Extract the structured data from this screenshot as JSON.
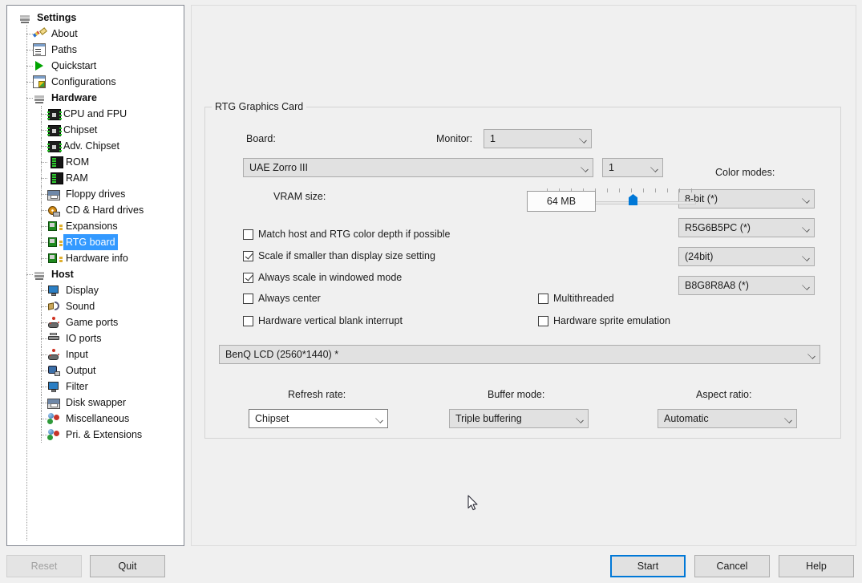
{
  "window": {
    "tree_root_label": "Settings"
  },
  "sidebar": {
    "items": [
      {
        "label": "Settings",
        "icon": "stack-icon",
        "level": 0,
        "bold": true,
        "selected": false
      },
      {
        "label": "About",
        "icon": "pencil-icon",
        "level": 1,
        "bold": false,
        "selected": false
      },
      {
        "label": "Paths",
        "icon": "window-icon",
        "level": 1,
        "bold": false,
        "selected": false
      },
      {
        "label": "Quickstart",
        "icon": "play-icon",
        "level": 1,
        "bold": false,
        "selected": false
      },
      {
        "label": "Configurations",
        "icon": "config-icon",
        "level": 1,
        "bold": false,
        "selected": false
      },
      {
        "label": "Hardware",
        "icon": "stack-icon",
        "level": 1,
        "bold": true,
        "selected": false
      },
      {
        "label": "CPU and FPU",
        "icon": "chip-icon",
        "level": 2,
        "bold": false,
        "selected": false
      },
      {
        "label": "Chipset",
        "icon": "chip-icon",
        "level": 2,
        "bold": false,
        "selected": false
      },
      {
        "label": "Adv. Chipset",
        "icon": "chip-icon",
        "level": 2,
        "bold": false,
        "selected": false
      },
      {
        "label": "ROM",
        "icon": "memory-icon",
        "level": 2,
        "bold": false,
        "selected": false
      },
      {
        "label": "RAM",
        "icon": "memory-icon",
        "level": 2,
        "bold": false,
        "selected": false
      },
      {
        "label": "Floppy drives",
        "icon": "floppy-icon",
        "level": 2,
        "bold": false,
        "selected": false
      },
      {
        "label": "CD & Hard drives",
        "icon": "cd-icon",
        "level": 2,
        "bold": false,
        "selected": false
      },
      {
        "label": "Expansions",
        "icon": "expansion-icon",
        "level": 2,
        "bold": false,
        "selected": false
      },
      {
        "label": "RTG board",
        "icon": "expansion-icon",
        "level": 2,
        "bold": false,
        "selected": true
      },
      {
        "label": "Hardware info",
        "icon": "expansion-icon",
        "level": 2,
        "bold": false,
        "selected": false
      },
      {
        "label": "Host",
        "icon": "stack-icon",
        "level": 1,
        "bold": true,
        "selected": false
      },
      {
        "label": "Display",
        "icon": "monitor-icon",
        "level": 2,
        "bold": false,
        "selected": false
      },
      {
        "label": "Sound",
        "icon": "sound-icon",
        "level": 2,
        "bold": false,
        "selected": false
      },
      {
        "label": "Game ports",
        "icon": "joystick-icon",
        "level": 2,
        "bold": false,
        "selected": false
      },
      {
        "label": "IO ports",
        "icon": "ioport-icon",
        "level": 2,
        "bold": false,
        "selected": false
      },
      {
        "label": "Input",
        "icon": "joystick-icon",
        "level": 2,
        "bold": false,
        "selected": false
      },
      {
        "label": "Output",
        "icon": "output-icon",
        "level": 2,
        "bold": false,
        "selected": false
      },
      {
        "label": "Filter",
        "icon": "monitor-icon",
        "level": 2,
        "bold": false,
        "selected": false
      },
      {
        "label": "Disk swapper",
        "icon": "floppy-icon",
        "level": 2,
        "bold": false,
        "selected": false
      },
      {
        "label": "Miscellaneous",
        "icon": "balls-icon",
        "level": 2,
        "bold": false,
        "selected": false
      },
      {
        "label": "Pri. & Extensions",
        "icon": "balls-icon",
        "level": 2,
        "bold": false,
        "selected": false
      }
    ]
  },
  "main": {
    "group_title": "RTG Graphics Card",
    "board_label": "Board:",
    "board_value": "UAE Zorro III",
    "monitor_label": "Monitor:",
    "monitor_value": "1",
    "monitor_index_value": "1",
    "color_modes_label": "Color modes:",
    "color_modes": [
      "8-bit (*)",
      "R5G6B5PC (*)",
      "(24bit)",
      "B8G8R8A8 (*)"
    ],
    "vram_label": "VRAM size:",
    "vram_value": "64 MB",
    "vram_slider": {
      "position_percent": 59,
      "tick_count": 13
    },
    "checkboxes_left": [
      {
        "label": "Match host and RTG color depth if possible",
        "checked": false
      },
      {
        "label": "Scale if smaller than display size setting",
        "checked": true
      },
      {
        "label": "Always scale in windowed mode",
        "checked": true
      },
      {
        "label": "Always center",
        "checked": false
      },
      {
        "label": "Hardware vertical blank interrupt",
        "checked": false
      }
    ],
    "checkboxes_right": [
      {
        "label": "Multithreaded",
        "checked": false
      },
      {
        "label": "Hardware sprite emulation",
        "checked": false
      }
    ],
    "display_mode_value": "BenQ LCD (2560*1440) *",
    "refresh_rate_label": "Refresh rate:",
    "refresh_rate_value": "Chipset",
    "buffer_mode_label": "Buffer mode:",
    "buffer_mode_value": "Triple buffering",
    "aspect_ratio_label": "Aspect ratio:",
    "aspect_ratio_value": "Automatic"
  },
  "footer": {
    "reset_label": "Reset",
    "quit_label": "Quit",
    "start_label": "Start",
    "cancel_label": "Cancel",
    "help_label": "Help"
  },
  "colors": {
    "accent": "#0078d7",
    "selection": "#3399ff",
    "window_bg": "#f0f0f0",
    "control_bg": "#e1e1e1",
    "control_border": "#acacac"
  }
}
